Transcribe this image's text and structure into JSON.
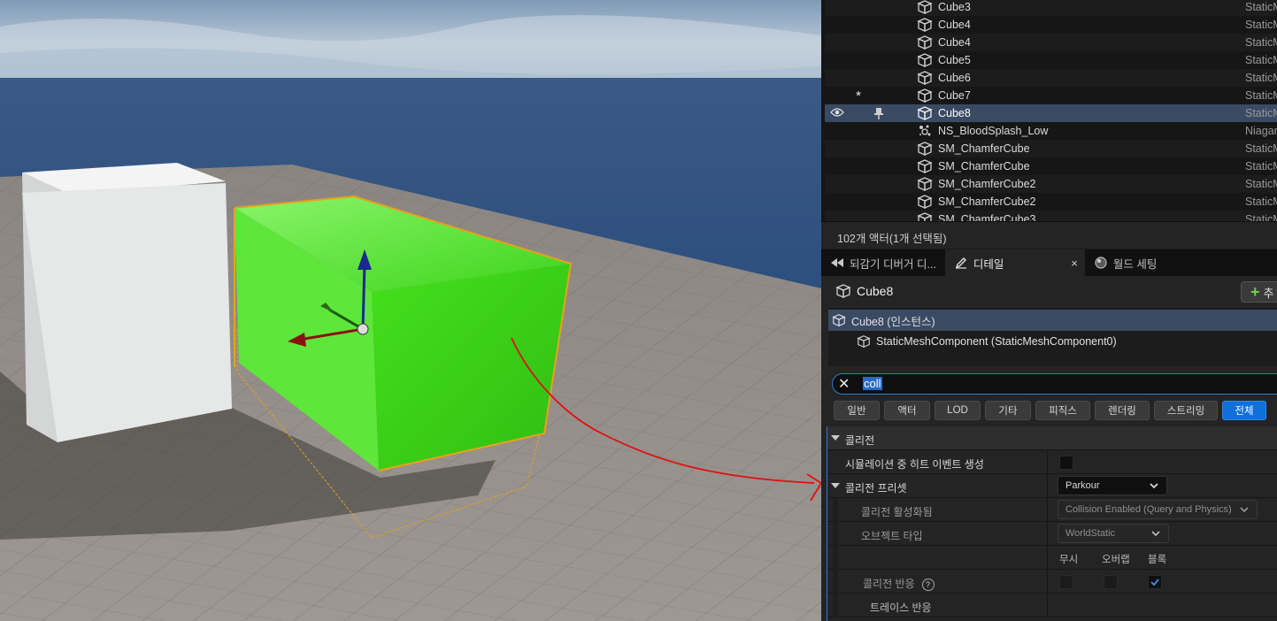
{
  "outliner": {
    "rows": [
      {
        "label": "Cube3",
        "type": "StaticM"
      },
      {
        "label": "Cube4",
        "type": "StaticM"
      },
      {
        "label": "Cube4",
        "type": "StaticM"
      },
      {
        "label": "Cube5",
        "type": "StaticM"
      },
      {
        "label": "Cube6",
        "type": "StaticM"
      },
      {
        "label": "Cube7",
        "type": "StaticM",
        "star": "*"
      },
      {
        "label": "Cube8",
        "type": "StaticM",
        "selected": true
      },
      {
        "label": "NS_BloodSplash_Low",
        "type": "Niagar"
      },
      {
        "label": "SM_ChamferCube",
        "type": "StaticM"
      },
      {
        "label": "SM_ChamferCube",
        "type": "StaticM"
      },
      {
        "label": "SM_ChamferCube2",
        "type": "StaticM"
      },
      {
        "label": "SM_ChamferCube2",
        "type": "StaticM"
      },
      {
        "label": "SM_ChamferCube3",
        "type": "StaticM"
      }
    ],
    "actor_count": "102개 액터(1개 선택됨)"
  },
  "tabs": [
    {
      "label": "되감기 디버거 디..."
    },
    {
      "label": "디테일",
      "close": "×"
    },
    {
      "label": "월드 세팅"
    }
  ],
  "details": {
    "title": "Cube8",
    "add_button": "추",
    "components": [
      {
        "label": "Cube8 (인스턴스)"
      },
      {
        "label": "StaticMeshComponent (StaticMeshComponent0)"
      }
    ],
    "search": {
      "value": "coll"
    },
    "filters": [
      "일반",
      "액터",
      "LOD",
      "기타",
      "피직스",
      "렌더링",
      "스트리밍",
      "전체"
    ],
    "active_filter": "전체",
    "category": "콜리전",
    "props": {
      "gen_hit_events": "시뮬레이션 중 히트 이벤트 생성",
      "collision_presets": "콜리전 프리셋",
      "presets_value": "Parkour",
      "collision_enabled": "콜리전 활성화됨",
      "collision_enabled_value": "Collision Enabled (Query and Physics)",
      "object_type": "오브젝트 타입",
      "object_type_value": "WorldStatic",
      "col_ignore": "무시",
      "col_overlap": "오버랩",
      "col_block": "블록",
      "collision_response": "콜리전 반응",
      "help": "?",
      "trace_response": "트레이스 반응"
    }
  },
  "colors": {
    "accent": "#0f6fdb",
    "selection": "#3b4a63",
    "cube_green": "#3ddc1a",
    "annotation_red": "#e01010"
  },
  "icons": {
    "visibility": "eye-icon",
    "pin": "pin-icon",
    "mesh": "static-mesh-icon",
    "niagara": "niagara-icon"
  }
}
